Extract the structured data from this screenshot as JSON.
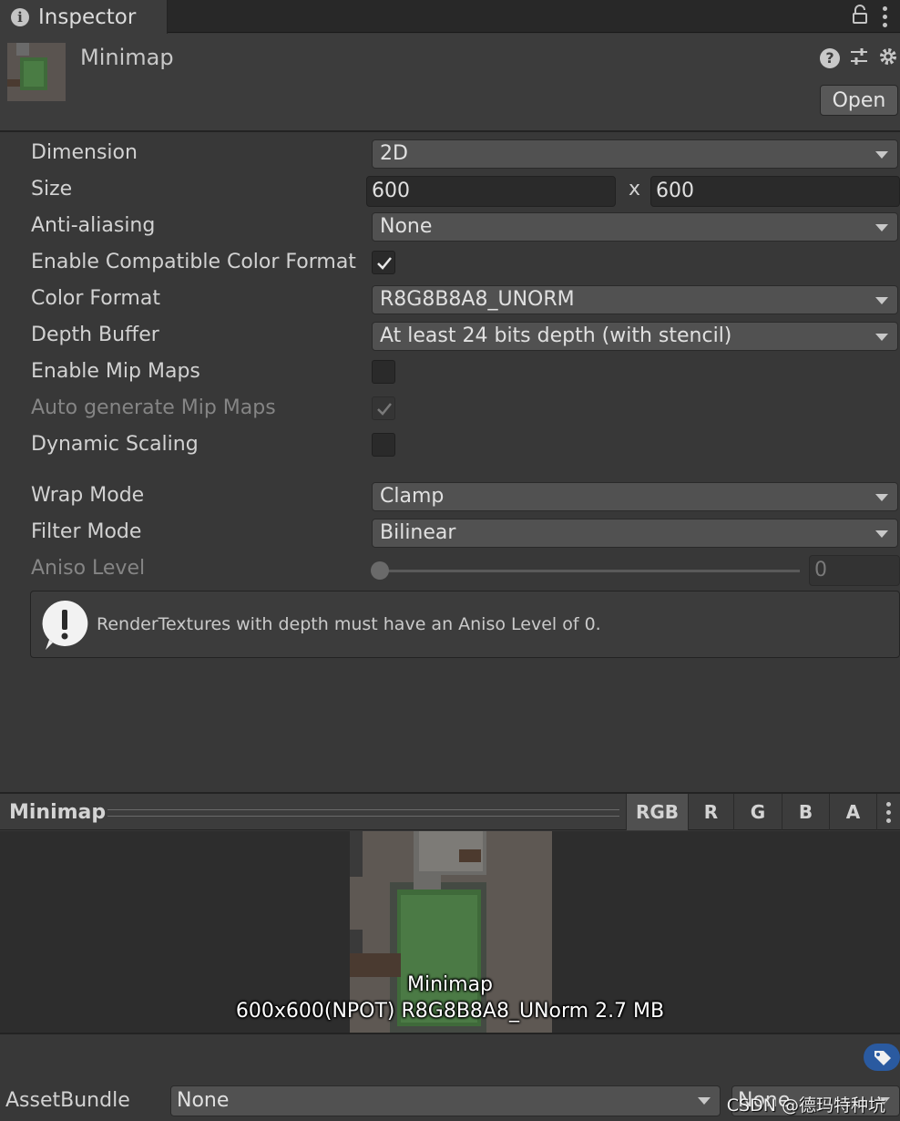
{
  "tab": {
    "title": "Inspector"
  },
  "header": {
    "asset_name": "Minimap",
    "open_label": "Open"
  },
  "properties": {
    "dimension": {
      "label": "Dimension",
      "value": "2D"
    },
    "size": {
      "label": "Size",
      "width": "600",
      "separator": "x",
      "height": "600"
    },
    "anti_aliasing": {
      "label": "Anti-aliasing",
      "value": "None"
    },
    "compatible_color_format": {
      "label": "Enable Compatible Color Format",
      "checked": true
    },
    "color_format": {
      "label": "Color Format",
      "value": "R8G8B8A8_UNORM"
    },
    "depth_buffer": {
      "label": "Depth Buffer",
      "value": "At least 24 bits depth (with stencil)"
    },
    "enable_mip_maps": {
      "label": "Enable Mip Maps",
      "checked": false
    },
    "auto_generate_mip_maps": {
      "label": "Auto generate Mip Maps",
      "checked": true,
      "disabled": true
    },
    "dynamic_scaling": {
      "label": "Dynamic Scaling",
      "checked": false
    },
    "wrap_mode": {
      "label": "Wrap Mode",
      "value": "Clamp"
    },
    "filter_mode": {
      "label": "Filter Mode",
      "value": "Bilinear"
    },
    "aniso_level": {
      "label": "Aniso Level",
      "value": "0",
      "slider_fraction": 0
    }
  },
  "helpbox": {
    "message": "RenderTextures with depth must have an Aniso Level of 0."
  },
  "preview": {
    "title": "Minimap",
    "channels": [
      "RGB",
      "R",
      "G",
      "B",
      "A"
    ],
    "active_channel": "RGB",
    "overlay_name": "Minimap",
    "overlay_info": "600x600(NPOT)  R8G8B8A8_UNorm  2.7 MB"
  },
  "asset_bundle": {
    "label": "AssetBundle",
    "name_value": "None",
    "variant_value": "None"
  },
  "watermark": "CSDN @德玛特种坑",
  "colors": {
    "accent_tag": "#2a5aa0",
    "panel": "#383838",
    "field": "#515151"
  }
}
